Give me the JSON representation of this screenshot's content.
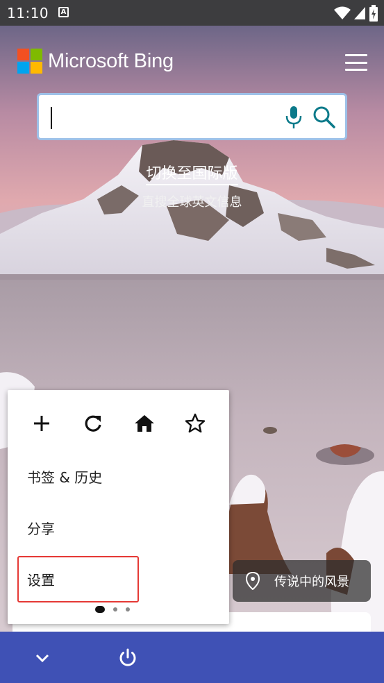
{
  "status_bar": {
    "time": "11:10",
    "notification_icon": "A"
  },
  "header": {
    "logo_text": "Microsoft Bing",
    "logo_colors": [
      "#f25022",
      "#7fba00",
      "#00a4ef",
      "#ffb900"
    ]
  },
  "search": {
    "value": "",
    "placeholder": "",
    "icon_color": "#0b7a8a"
  },
  "switch": {
    "link": "切换至国际版",
    "subtitle": "直搜全球英文信息"
  },
  "popup": {
    "toolbar_icons": [
      "plus-icon",
      "refresh-icon",
      "home-icon",
      "star-icon"
    ],
    "items": [
      {
        "label": "书签 & 历史"
      },
      {
        "label": "分享"
      },
      {
        "label": "设置"
      }
    ],
    "highlight_color": "#e53935"
  },
  "location": {
    "label": "传说中的风景"
  },
  "bottom_bar": {
    "color": "#3f51b5",
    "icons": [
      "chevron-down-icon",
      "power-icon"
    ]
  }
}
